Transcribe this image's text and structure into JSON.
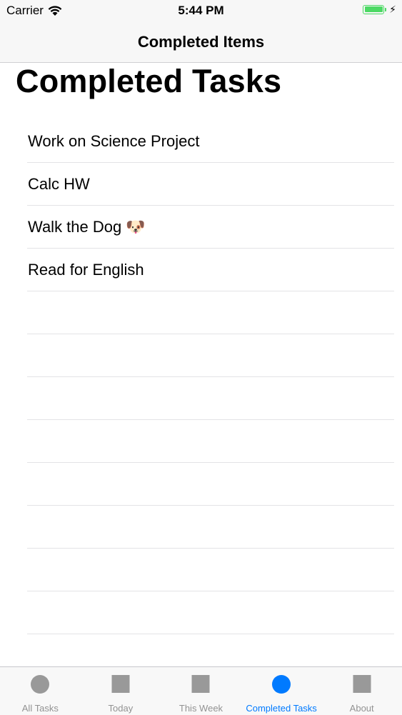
{
  "status": {
    "carrier": "Carrier",
    "time": "5:44 PM",
    "battery_level": 1.0,
    "accent": "#4cd964"
  },
  "nav": {
    "title": "Completed Items"
  },
  "page": {
    "title": "Completed Tasks"
  },
  "tasks": [
    {
      "label": "Work on Science Project"
    },
    {
      "label": "Calc HW"
    },
    {
      "label": "Walk the Dog 🐶"
    },
    {
      "label": "Read for English"
    }
  ],
  "tabs": [
    {
      "label": "All Tasks",
      "icon": "circle-icon",
      "active": false
    },
    {
      "label": "Today",
      "icon": "square-icon",
      "active": false
    },
    {
      "label": "This Week",
      "icon": "square-icon",
      "active": false
    },
    {
      "label": "Completed Tasks",
      "icon": "circle-icon",
      "active": true
    },
    {
      "label": "About",
      "icon": "square-icon",
      "active": false
    }
  ],
  "colors": {
    "tab_active": "#007aff",
    "tab_inactive": "#929292"
  }
}
